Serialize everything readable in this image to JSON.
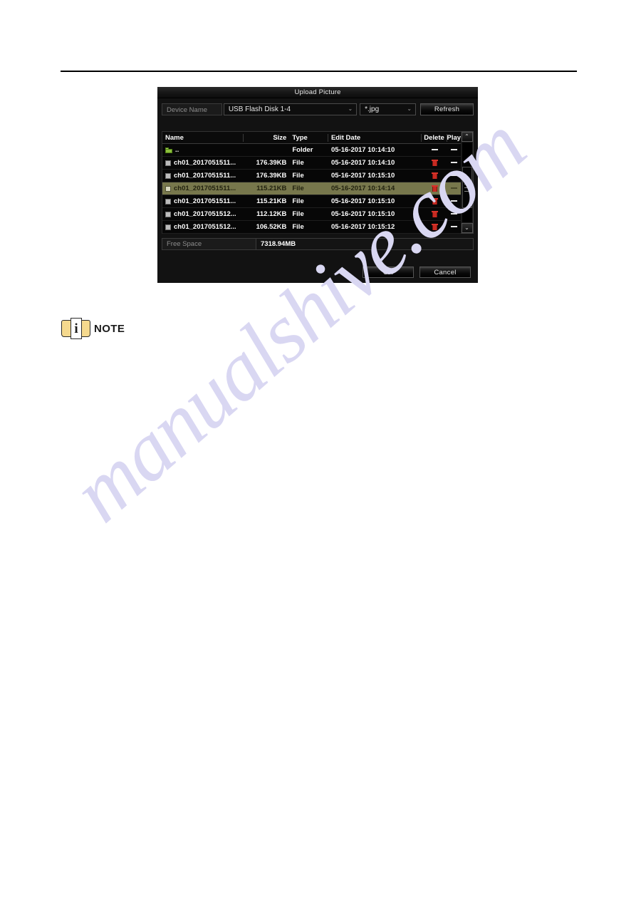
{
  "page": {
    "watermark": "manualshive.com",
    "note_label": "NOTE",
    "note_icon_letter": "i"
  },
  "dialog": {
    "title": "Upload Picture",
    "toolbar": {
      "device_label": "Device Name",
      "device_value": "USB Flash Disk 1-4",
      "filetype_value": "*.jpg",
      "refresh_label": "Refresh",
      "chevron": "⌄"
    },
    "table": {
      "columns": [
        "Name",
        "Size",
        "Type",
        "Edit Date",
        "Delete",
        "Play"
      ],
      "rows": [
        {
          "icon": "folder-up-icon",
          "name": "..",
          "size": "",
          "type": "Folder",
          "date": "05-16-2017 10:14:10",
          "delete": "dash",
          "play": "dash",
          "selected": false
        },
        {
          "icon": "checkbox-icon",
          "name": "ch01_2017051511...",
          "size": "176.39KB",
          "type": "File",
          "date": "05-16-2017 10:14:10",
          "delete": "trash",
          "play": "dash",
          "selected": false
        },
        {
          "icon": "checkbox-icon",
          "name": "ch01_2017051511...",
          "size": "176.39KB",
          "type": "File",
          "date": "05-16-2017 10:15:10",
          "delete": "trash",
          "play": "dash",
          "selected": false
        },
        {
          "icon": "checkbox-icon",
          "name": "ch01_2017051511...",
          "size": "115.21KB",
          "type": "File",
          "date": "05-16-2017 10:14:14",
          "delete": "trash",
          "play": "dash",
          "selected": true
        },
        {
          "icon": "checkbox-icon",
          "name": "ch01_2017051511...",
          "size": "115.21KB",
          "type": "File",
          "date": "05-16-2017 10:15:10",
          "delete": "trash",
          "play": "dash",
          "selected": false
        },
        {
          "icon": "checkbox-icon",
          "name": "ch01_2017051512...",
          "size": "112.12KB",
          "type": "File",
          "date": "05-16-2017 10:15:10",
          "delete": "trash",
          "play": "dash",
          "selected": false
        },
        {
          "icon": "checkbox-icon",
          "name": "ch01_2017051512...",
          "size": "106.52KB",
          "type": "File",
          "date": "05-16-2017 10:15:12",
          "delete": "trash",
          "play": "dash",
          "selected": false
        }
      ]
    },
    "scrollbar": {
      "up_glyph": "⌃",
      "down_glyph": "⌄"
    },
    "free_space": {
      "label": "Free Space",
      "value": "7318.94MB"
    },
    "footer": {
      "ok_label": "OK",
      "cancel_label": "Cancel"
    }
  },
  "colors": {
    "dialog_bg": "#121212",
    "selection": "#77774c",
    "delete_icon": "#c62b22",
    "folder_icon": "#8bbf3c",
    "note_icon": "#f5d98e",
    "watermark": "#d9d7f2"
  }
}
